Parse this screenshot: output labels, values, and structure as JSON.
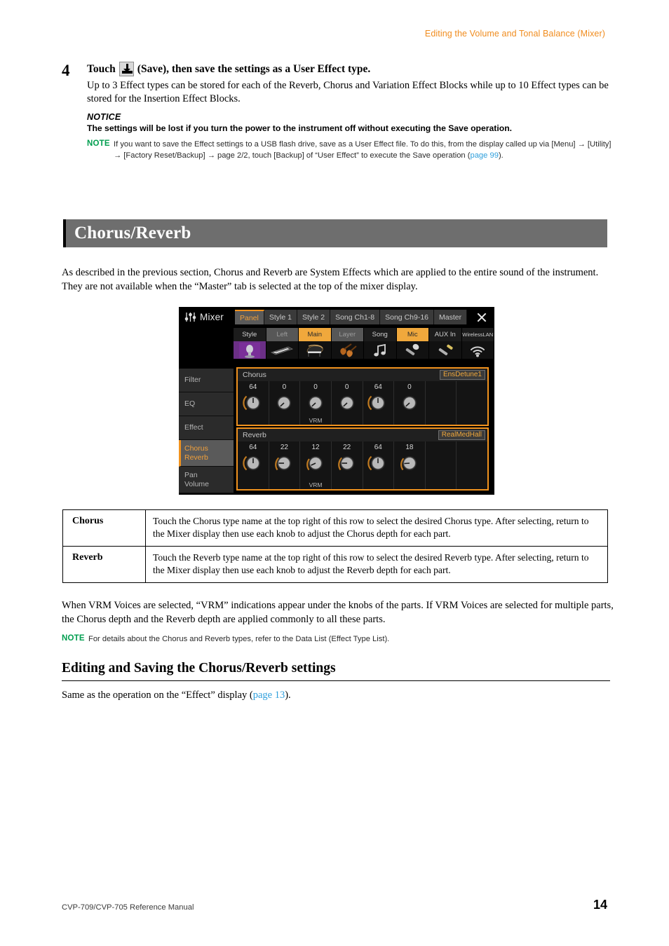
{
  "header": {
    "running_title": "Editing the Volume and Tonal Balance (Mixer)",
    "running_title_color": "#f08c1e"
  },
  "step": {
    "number": "4",
    "title_before_icon": "Touch",
    "icon_name": "save-icon",
    "title_after_icon": "(Save), then save the settings as a User Effect type.",
    "body": "Up to 3 Effect types can be stored for each of the Reverb, Chorus and Variation Effect Blocks while up to 10 Effect types can be stored for the Insertion Effect Blocks.",
    "notice_label": "NOTICE",
    "notice_text": "The settings will be lost if you turn the power to the instrument off without executing the Save operation.",
    "note_tag": "NOTE",
    "note_text_1": "If you want to save the Effect settings to a USB flash drive, save as a User Effect file. To do this, from the display called up via [Menu] ",
    "note_arrow": "→",
    "note_text_2": " [Utility] ",
    "note_text_3": " [Factory Reset/Backup] ",
    "note_text_4": " page 2/2, touch [Backup] of “User Effect” to execute the Save operation (",
    "note_link": "page 99",
    "note_text_5": ")."
  },
  "section": {
    "title": "Chorus/Reverb",
    "bar_color": "#6e6e6e",
    "intro": "As described in the previous section, Chorus and Reverb are System Effects which are applied to the entire sound of the instrument. They are not available when the “Master” tab is selected at the top of the mixer display."
  },
  "mixer": {
    "app_title": "Mixer",
    "logo_icon": "fader-icon",
    "close_icon": "close-icon",
    "top_tabs": [
      {
        "label": "Panel",
        "active": true
      },
      {
        "label": "Style 1",
        "active": false
      },
      {
        "label": "Style 2",
        "active": false
      },
      {
        "label": "Song Ch1-8",
        "active": false
      },
      {
        "label": "Song Ch9-16",
        "active": false
      },
      {
        "label": "Master",
        "active": false
      }
    ],
    "part_tabs": [
      {
        "label": "Style",
        "state": "normal",
        "icon": "microphone-stage-photo-icon"
      },
      {
        "label": "Left",
        "state": "dim",
        "icon": "keyboard-icon"
      },
      {
        "label": "Main",
        "state": "on",
        "icon": "grand-piano-icon"
      },
      {
        "label": "Layer",
        "state": "dim",
        "icon": "strings-icon"
      },
      {
        "label": "Song",
        "state": "normal",
        "icon": "music-note-icon"
      },
      {
        "label": "Mic",
        "state": "on",
        "icon": "microphone-icon"
      },
      {
        "label": "AUX In",
        "state": "normal",
        "icon": "audio-plug-icon"
      },
      {
        "label": "WirelessLAN",
        "state": "normal",
        "icon": "wifi-icon"
      }
    ],
    "sidebar": [
      {
        "lines": [
          "Filter"
        ],
        "active": false
      },
      {
        "lines": [
          "EQ"
        ],
        "active": false
      },
      {
        "lines": [
          "Effect"
        ],
        "active": false
      },
      {
        "lines": [
          "Chorus",
          "Reverb"
        ],
        "active": true
      },
      {
        "lines": [
          "Pan",
          "Volume"
        ],
        "active": false
      }
    ],
    "chorus": {
      "label": "Chorus",
      "type": "EnsDetune1",
      "values": [
        "64",
        "0",
        "0",
        "0",
        "64",
        "0",
        "",
        ""
      ],
      "vrm_index": 2,
      "vrm_label": "VRM"
    },
    "reverb": {
      "label": "Reverb",
      "type": "RealMedHall",
      "values": [
        "64",
        "22",
        "12",
        "22",
        "64",
        "18",
        "",
        ""
      ],
      "vrm_index": 2,
      "vrm_label": "VRM"
    },
    "accent_color": "#f0921e"
  },
  "desc_table": {
    "rows": [
      {
        "term": "Chorus",
        "description": "Touch the Chorus type name at the top right of this row to select the desired Chorus type. After selecting, return to the Mixer display then use each knob to adjust the Chorus depth for each part."
      },
      {
        "term": "Reverb",
        "description": "Touch the Reverb type name at the top right of this row to select the desired Reverb type. After selecting, return to the Mixer display then use each knob to adjust the Reverb depth for each part."
      }
    ]
  },
  "post": {
    "paragraph": "When VRM Voices are selected, “VRM” indications appear under the knobs of the parts. If VRM Voices are selected for multiple parts, the Chorus depth and the Reverb depth are applied commonly to all these parts.",
    "note_tag": "NOTE",
    "note_text": "For details about the Chorus and Reverb types, refer to the Data List (Effect Type List)."
  },
  "subsection": {
    "title": "Editing and Saving the Chorus/Reverb settings",
    "text_before_link": "Same as the operation on the “Effect” display (",
    "link": "page 13",
    "text_after_link": ")."
  },
  "footer": {
    "left": "CVP-709/CVP-705 Reference Manual",
    "page": "14"
  }
}
